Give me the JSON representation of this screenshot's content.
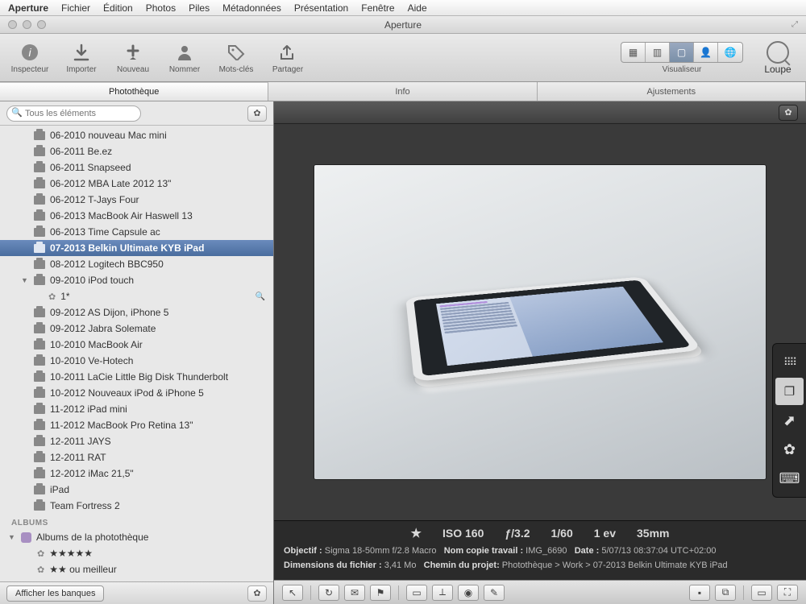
{
  "menubar": {
    "app": "Aperture",
    "items": [
      "Fichier",
      "Édition",
      "Photos",
      "Piles",
      "Métadonnées",
      "Présentation",
      "Fenêtre",
      "Aide"
    ]
  },
  "window": {
    "title": "Aperture"
  },
  "toolbar": {
    "left": [
      {
        "label": "Inspecteur",
        "icon": "info"
      },
      {
        "label": "Importer",
        "icon": "download"
      },
      {
        "label": "Nouveau",
        "icon": "plus"
      },
      {
        "label": "Nommer",
        "icon": "person"
      },
      {
        "label": "Mots-clés",
        "icon": "tag"
      },
      {
        "label": "Partager",
        "icon": "share"
      }
    ],
    "viewmode_label": "Visualiseur",
    "loupe_label": "Loupe"
  },
  "inspector_tabs": [
    "Photothèque",
    "Info",
    "Ajustements"
  ],
  "search": {
    "placeholder": "Tous les éléments"
  },
  "tree": {
    "items": [
      {
        "label": "06-2010 nouveau Mac mini"
      },
      {
        "label": "06-2011 Be.ez"
      },
      {
        "label": "06-2011 Snapseed"
      },
      {
        "label": "06-2012 MBA Late 2012 13\""
      },
      {
        "label": "06-2012 T-Jays Four"
      },
      {
        "label": "06-2013 MacBook Air Haswell 13"
      },
      {
        "label": "06-2013 Time Capsule ac"
      },
      {
        "label": "07-2013 Belkin Ultimate KYB iPad",
        "selected": true
      },
      {
        "label": "08-2012 Logitech BBC950"
      },
      {
        "label": "09-2010 iPod touch",
        "expanded": true,
        "children": [
          {
            "label": "1*",
            "smart": true
          }
        ]
      },
      {
        "label": "09-2012 AS Dijon, iPhone 5"
      },
      {
        "label": "09-2012 Jabra Solemate"
      },
      {
        "label": "10-2010 MacBook Air"
      },
      {
        "label": "10-2010 Ve-Hotech"
      },
      {
        "label": "10-2011 LaCie Little Big Disk Thunderbolt"
      },
      {
        "label": "10-2012 Nouveaux iPod & iPhone 5"
      },
      {
        "label": "11-2012 iPad mini"
      },
      {
        "label": "11-2012 MacBook Pro Retina 13\""
      },
      {
        "label": "12-2011 JAYS"
      },
      {
        "label": "12-2011 RAT"
      },
      {
        "label": "12-2012 iMac 21,5\""
      },
      {
        "label": "iPad"
      },
      {
        "label": "Team Fortress 2"
      }
    ],
    "albums_header": "ALBUMS",
    "albums": [
      {
        "label": "Albums de la photothèque",
        "expanded": true
      },
      {
        "label": "★★★★★",
        "smart": true,
        "nested": true
      },
      {
        "label": "★★ ou meilleur",
        "smart": true,
        "nested": true
      }
    ]
  },
  "sidebar_footer": {
    "button": "Afficher les banques"
  },
  "metadata": {
    "rating": "★",
    "iso": "ISO 160",
    "aperture": "ƒ/3.2",
    "shutter": "1/60",
    "ev": "1 ev",
    "focal": "35mm",
    "lens_label": "Objectif :",
    "lens": "Sigma 18-50mm f/2.8 Macro",
    "copyname_label": "Nom copie travail :",
    "copyname": "IMG_6690",
    "date_label": "Date :",
    "date": "5/07/13 08:37:04 UTC+02:00",
    "filesize_label": "Dimensions du fichier :",
    "filesize": "3,41 Mo",
    "path_label": "Chemin du projet:",
    "path": "Photothèque > Work > 07-2013 Belkin Ultimate KYB iPad"
  }
}
